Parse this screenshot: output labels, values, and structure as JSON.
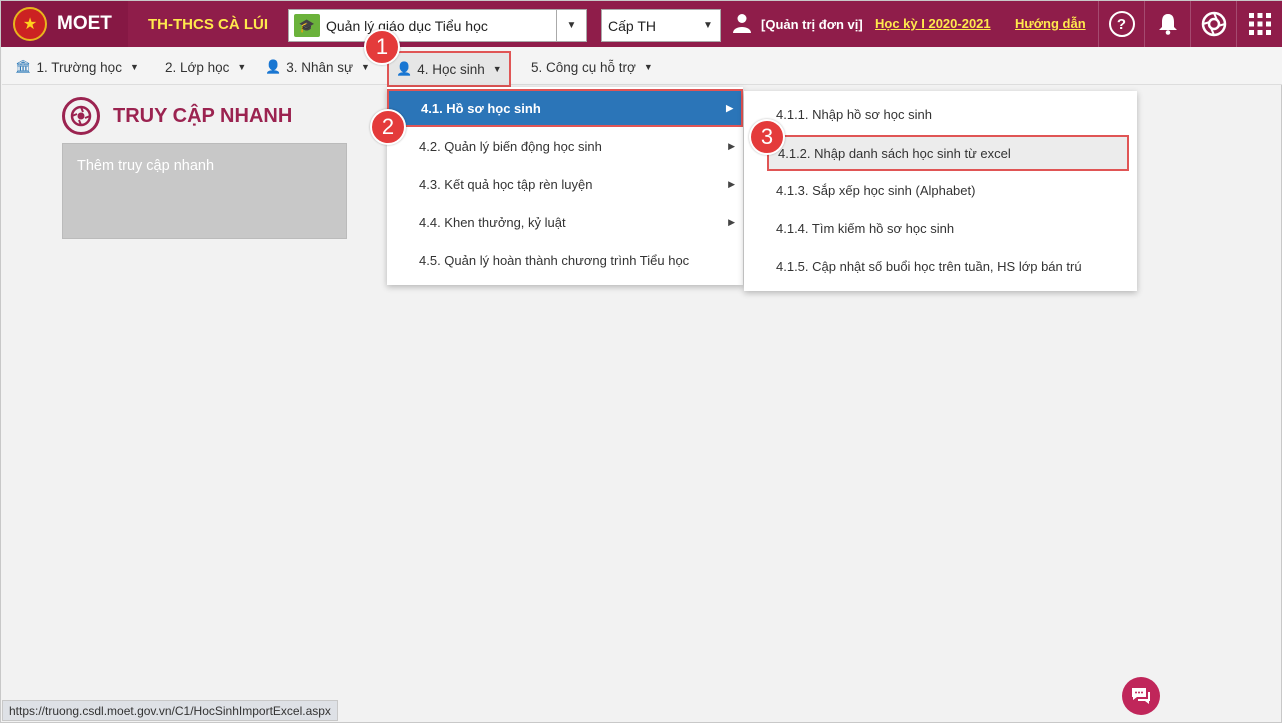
{
  "header": {
    "brand": "MOET",
    "school": "TH-THCS CÀ LÚI",
    "system_select": "Quản lý giáo dục Tiểu học",
    "level_select": "Cấp TH",
    "role": "[Quản trị đơn vị]",
    "term": "Học kỳ I 2020-2021",
    "help": "Hướng dẫn",
    "help_icon": "?"
  },
  "nav": {
    "items": [
      {
        "label": "1. Trường học"
      },
      {
        "label": "2. Lớp học"
      },
      {
        "label": "3. Nhân sự"
      },
      {
        "label": "4. Học sinh"
      },
      {
        "label": "5. Công cụ hỗ trợ"
      }
    ]
  },
  "quick_access": {
    "title": "TRUY CẬP NHANH",
    "add": "Thêm truy cập nhanh"
  },
  "menu_students": {
    "items": [
      {
        "label": "4.1. Hồ sơ học sinh"
      },
      {
        "label": "4.2. Quản lý biến động học sinh"
      },
      {
        "label": "4.3. Kết quả học tập rèn luyện"
      },
      {
        "label": "4.4. Khen thưởng, kỷ luật"
      },
      {
        "label": "4.5. Quản lý hoàn thành chương trình Tiểu học"
      }
    ]
  },
  "menu_profile": {
    "items": [
      {
        "label": "4.1.1. Nhập hồ sơ học sinh"
      },
      {
        "label": "4.1.2. Nhập danh sách học sinh từ excel"
      },
      {
        "label": "4.1.3. Sắp xếp học sinh (Alphabet)"
      },
      {
        "label": "4.1.4. Tìm kiếm hồ sơ học sinh"
      },
      {
        "label": "4.1.5. Cập nhật số buổi học trên tuần, HS lớp bán trú"
      }
    ]
  },
  "badges": [
    "1",
    "2",
    "3"
  ],
  "status_url": "https://truong.csdl.moet.gov.vn/C1/HocSinhImportExcel.aspx",
  "colors": {
    "header_bg": "#8f1d4a",
    "accent_yellow": "#ffe94c",
    "menu_active": "#2b75b8",
    "highlight_red": "#e05555"
  }
}
